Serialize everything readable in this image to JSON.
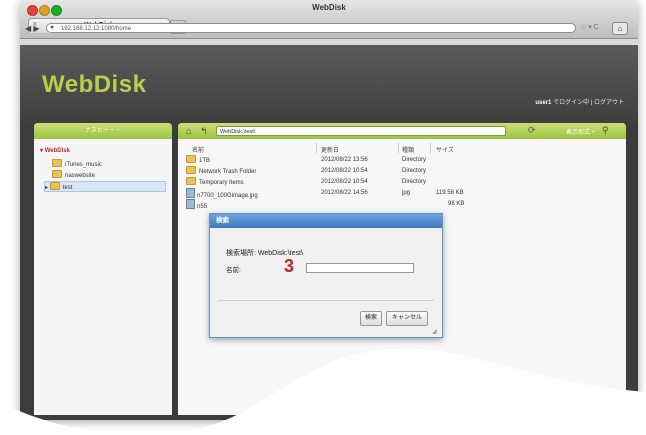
{
  "window": {
    "title": "WebDisk"
  },
  "tab": {
    "label": "WebDisk",
    "close": "x",
    "new": "+"
  },
  "urlbar": {
    "url": "192.168.12.12:1080/home"
  },
  "toolbar": {
    "refresh": "☆ ▾ C",
    "home": "⌂",
    "nav": "◀ ▶"
  },
  "app": {
    "logo": "WebDisk",
    "user_name": "user1",
    "login_status": "でログイン中",
    "logout": "ログアウト"
  },
  "left_panel": {
    "header": "ナスヒー・・",
    "root": "WebDisk",
    "items": [
      {
        "label": "iTunes_music",
        "selected": false
      },
      {
        "label": "naswebsite",
        "selected": false
      },
      {
        "label": "test",
        "selected": true
      }
    ]
  },
  "right_panel": {
    "path": "WebDisk:\\test\\",
    "view_label": "表示形式・",
    "columns": [
      "名前",
      "更新日",
      "種類",
      "サイズ"
    ],
    "files": [
      {
        "name": "1TB",
        "date": "2012/08/22 13:56",
        "type": "Directory",
        "size": "",
        "kind": "folder"
      },
      {
        "name": "Network Trash Folder",
        "date": "2012/08/22 10:54",
        "type": "Directory",
        "size": "",
        "kind": "folder"
      },
      {
        "name": "Temporary Items",
        "date": "2012/08/22 10:54",
        "type": "Directory",
        "size": "",
        "kind": "folder"
      },
      {
        "name": "n7700_100Gimage.jpg",
        "date": "2012/08/22 14:56",
        "type": "jpg",
        "size": "119.58 KB",
        "kind": "image"
      },
      {
        "name": "n55",
        "date": "",
        "type": "",
        "size": "98 KB",
        "kind": "image"
      }
    ]
  },
  "dialog": {
    "title": "検索",
    "location_label": "検索場所: WebDisk:\\test\\",
    "name_label": "名前:",
    "name_value": "",
    "search_button": "検索",
    "cancel_button": "キャンセル"
  },
  "annotation": {
    "step": "3"
  },
  "colors": {
    "accent": "#9ac23e",
    "logo": "#b3d24a",
    "dialog_title": "#3b79bc",
    "step": "#c0212c"
  }
}
